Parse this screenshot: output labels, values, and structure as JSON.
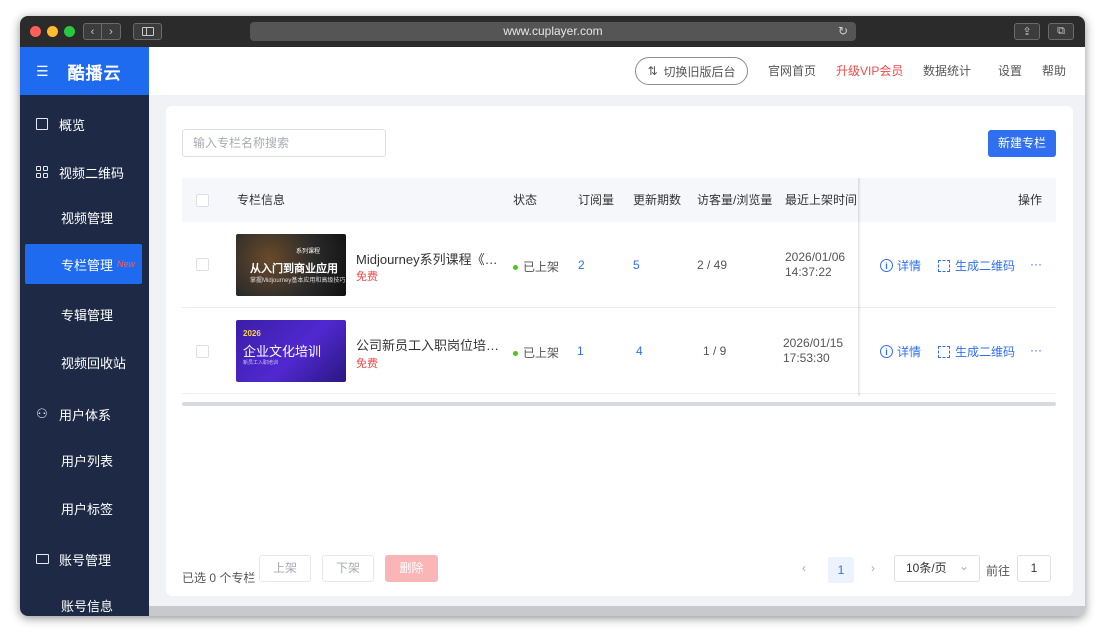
{
  "browser": {
    "url": "www.cuplayer.com",
    "reload_icon": "reload-icon",
    "nav_back": "‹",
    "nav_forward": "›",
    "share_icon": "⇪",
    "tabs_icon": "⧉"
  },
  "app": {
    "brand": "酷播云",
    "menu_icon": "☰",
    "accent": "#1e6bf0",
    "sidebar_bg": "#1e2a45"
  },
  "sidebar": {
    "items": [
      {
        "label": "概览",
        "type": "group",
        "icon": "chart-icon"
      },
      {
        "label": "视频二维码",
        "type": "group",
        "icon": "grid-icon"
      },
      {
        "label": "视频管理",
        "type": "sub"
      },
      {
        "label": "专栏管理",
        "type": "sub",
        "active": true,
        "badge": "New"
      },
      {
        "label": "专辑管理",
        "type": "sub"
      },
      {
        "label": "视频回收站",
        "type": "sub"
      },
      {
        "label": "用户体系",
        "type": "group",
        "icon": "user-icon"
      },
      {
        "label": "用户列表",
        "type": "sub"
      },
      {
        "label": "用户标签",
        "type": "sub"
      },
      {
        "label": "账号管理",
        "type": "group",
        "icon": "id-card-icon"
      },
      {
        "label": "账号信息",
        "type": "sub"
      }
    ]
  },
  "header": {
    "switch_label": "切换旧版后台",
    "switch_icon": "⇅",
    "nav": [
      "官网首页",
      "升级VIP会员",
      "数据统计",
      "设置",
      "帮助"
    ]
  },
  "toolbar": {
    "search_placeholder": "输入专栏名称搜索",
    "new_button": "新建专栏"
  },
  "table": {
    "columns": [
      "专栏信息",
      "状态",
      "订阅量",
      "更新期数",
      "访客量/浏览量",
      "最近上架时间",
      "操作"
    ],
    "rows": [
      {
        "title": "Midjourney系列课程《从...",
        "price": "免费",
        "status": "已上架",
        "subscriptions": "2",
        "issues": "5",
        "views": "2 / 49",
        "date": "2026/01/06",
        "time": "14:37:22",
        "thumb_title": "从入门到商业应用",
        "thumb_label": "系列课程",
        "thumb_sub": "掌握Midjourney基本应用和高级技巧"
      },
      {
        "title": "公司新员工入职岗位培训...",
        "price": "免费",
        "status": "已上架",
        "subscriptions": "1",
        "issues": "4",
        "views": "1 / 9",
        "date": "2026/01/15",
        "time": "17:53:30",
        "thumb_title": "企业文化培训",
        "thumb_num": "2026",
        "thumb_sub": "新员工入职培训"
      }
    ],
    "actions": {
      "detail": "详情",
      "qr": "生成二维码",
      "more": "···"
    }
  },
  "footer": {
    "selected": "已选 0 个专栏",
    "btn_up": "上架",
    "btn_down": "下架",
    "btn_delete": "删除",
    "prev": "‹",
    "next": "›",
    "current_page": "1",
    "page_size": "10条/页",
    "page_size_arrow": "⌄",
    "goto_label": "前往",
    "goto_value": "1"
  }
}
